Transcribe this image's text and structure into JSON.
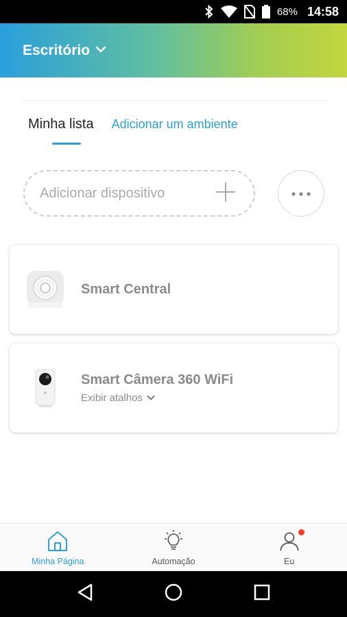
{
  "status_bar": {
    "battery": "68%",
    "time": "14:58",
    "icons": [
      "bluetooth-icon",
      "wifi-icon",
      "no-sim-icon",
      "battery-icon"
    ]
  },
  "header": {
    "location": "Escritório"
  },
  "tabs": {
    "active_label": "Minha lista",
    "add_room_label": "Adicionar um ambiente"
  },
  "add_device": {
    "placeholder": "Adicionar dispositivo"
  },
  "devices": [
    {
      "name": "Smart Central",
      "icon": "smart-hub-icon"
    },
    {
      "name": "Smart Câmera 360 WiFi",
      "shortcuts_label": "Exibir atalhos",
      "icon": "camera-device-icon"
    }
  ],
  "bottom_nav": [
    {
      "label": "Minha Página",
      "icon": "home-icon",
      "active": true
    },
    {
      "label": "Automação",
      "icon": "lightbulb-icon",
      "active": false
    },
    {
      "label": "Eu",
      "icon": "user-icon",
      "active": false,
      "badge": true
    }
  ],
  "colors": {
    "accent": "#2a9fdc",
    "header_gradient_start": "#2a9fdc",
    "header_gradient_end": "#c4d63e",
    "badge": "#ff3b30"
  }
}
